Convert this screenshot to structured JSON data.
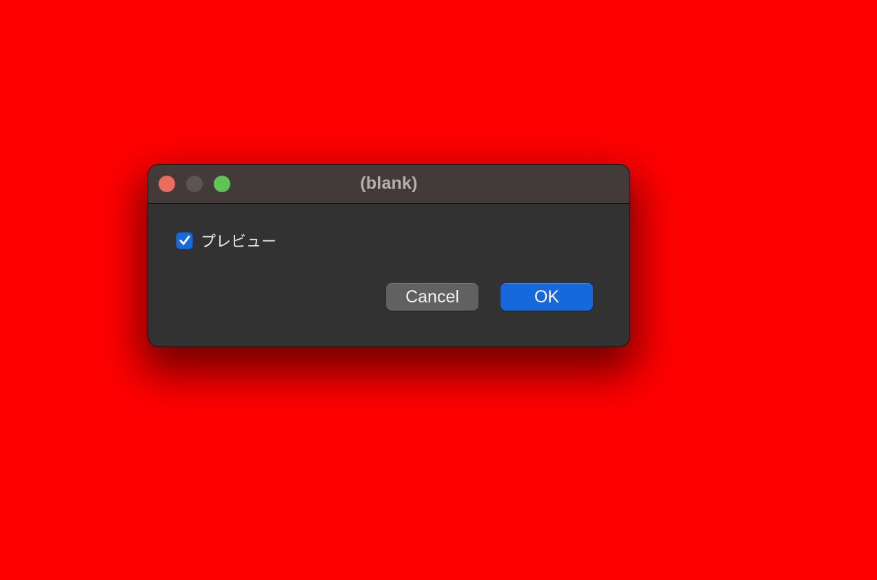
{
  "window": {
    "title": "(blank)"
  },
  "controls": {
    "close_icon": "close-icon",
    "minimize_icon": "minimize-icon",
    "zoom_icon": "zoom-icon",
    "close_color": "#ec6a5e",
    "minimize_color": "#5a5554",
    "zoom_color": "#5fc452"
  },
  "preview": {
    "label": "プレビュー",
    "checked": true,
    "icon": "checkmark-icon"
  },
  "buttons": {
    "cancel_label": "Cancel",
    "ok_label": "OK"
  },
  "colors": {
    "desktop_background": "#ff0000",
    "accent": "#1668dc",
    "dialog_background": "#323232",
    "titlebar_background": "#433b39"
  }
}
